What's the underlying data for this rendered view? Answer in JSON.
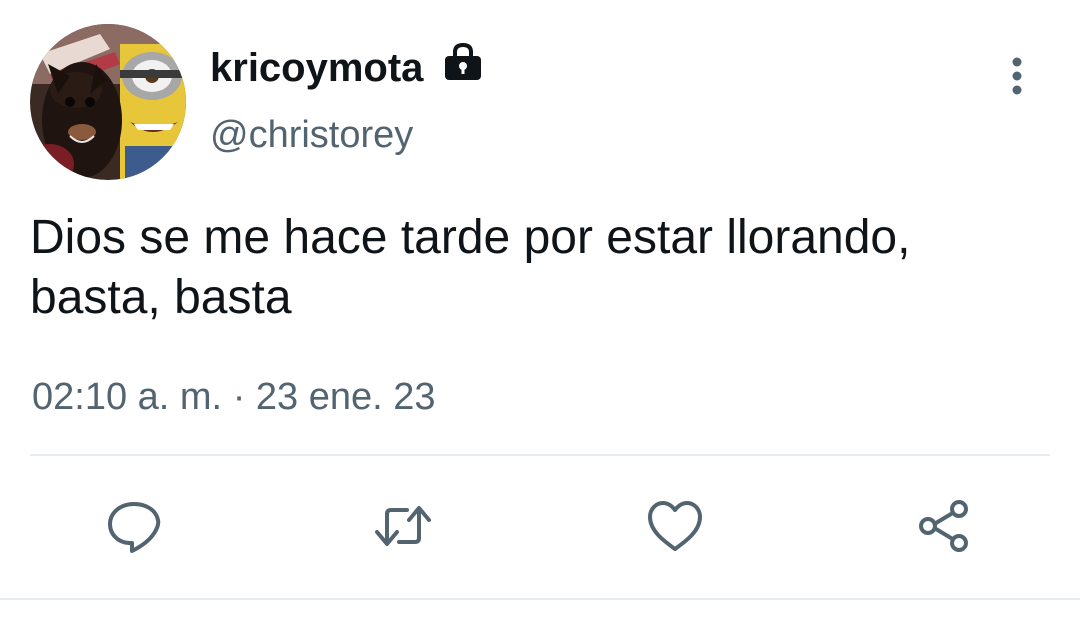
{
  "tweet": {
    "author": {
      "display_name": "kricoymota",
      "handle": "@christorey",
      "protected": true,
      "avatar_icon": "avatar-photo"
    },
    "text_line1": "Dios se me hace tarde por estar llorando,",
    "text_line2": "basta, basta",
    "time": "02:10 a. m.",
    "separator": "·",
    "date": "23 ene. 23"
  },
  "actions": {
    "reply_icon": "reply-icon",
    "retweet_icon": "retweet-icon",
    "like_icon": "heart-icon",
    "share_icon": "share-icon",
    "more_icon": "more-vertical-icon"
  },
  "colors": {
    "text": "#0f1419",
    "secondary": "#536471",
    "divider": "#e6ecf0"
  }
}
